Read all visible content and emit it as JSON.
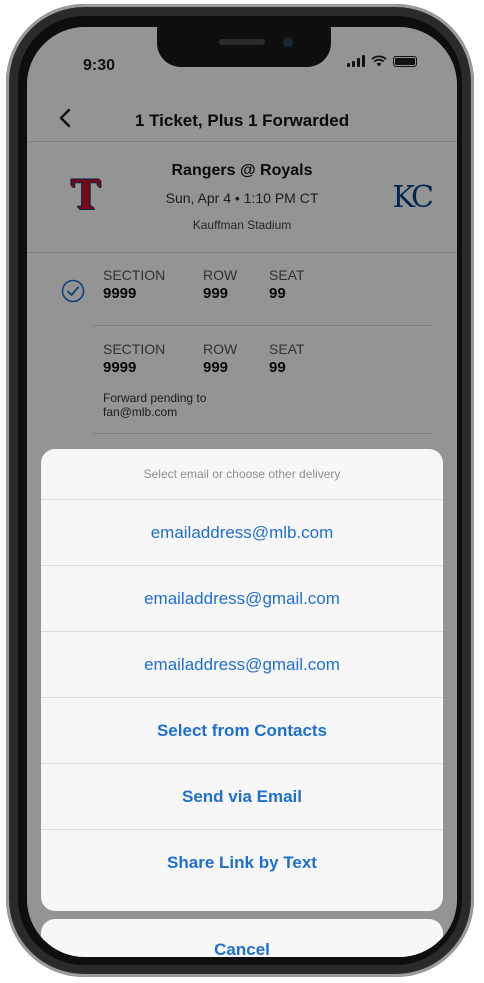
{
  "status_bar": {
    "time": "9:30"
  },
  "nav": {
    "title": "1 Ticket, Plus 1 Forwarded"
  },
  "game": {
    "matchup": "Rangers @ Royals",
    "datetime": "Sun, Apr 4 • 1:10 PM CT",
    "venue": "Kauffman Stadium",
    "home_logo_text": "KC",
    "away_logo_text": "T"
  },
  "tickets": [
    {
      "section_label": "SECTION",
      "row_label": "ROW",
      "seat_label": "SEAT",
      "section": "9999",
      "row": "999",
      "seat": "99",
      "note": ""
    },
    {
      "section_label": "SECTION",
      "row_label": "ROW",
      "seat_label": "SEAT",
      "section": "9999",
      "row": "999",
      "seat": "99",
      "note": "Forward pending to fan@mlb.com"
    }
  ],
  "sheet": {
    "header": "Select email or choose other delivery",
    "options": [
      "emailaddress@mlb.com",
      "emailaddress@gmail.com",
      "emailaddress@gmail.com",
      "Select from Contacts",
      "Send via Email",
      "Share Link by Text"
    ],
    "cancel": "Cancel"
  },
  "colors": {
    "accent": "#1e6fd0",
    "rangers_red": "#c8102e",
    "royals_blue": "#004687",
    "forward_button": "#1f5bb5"
  }
}
